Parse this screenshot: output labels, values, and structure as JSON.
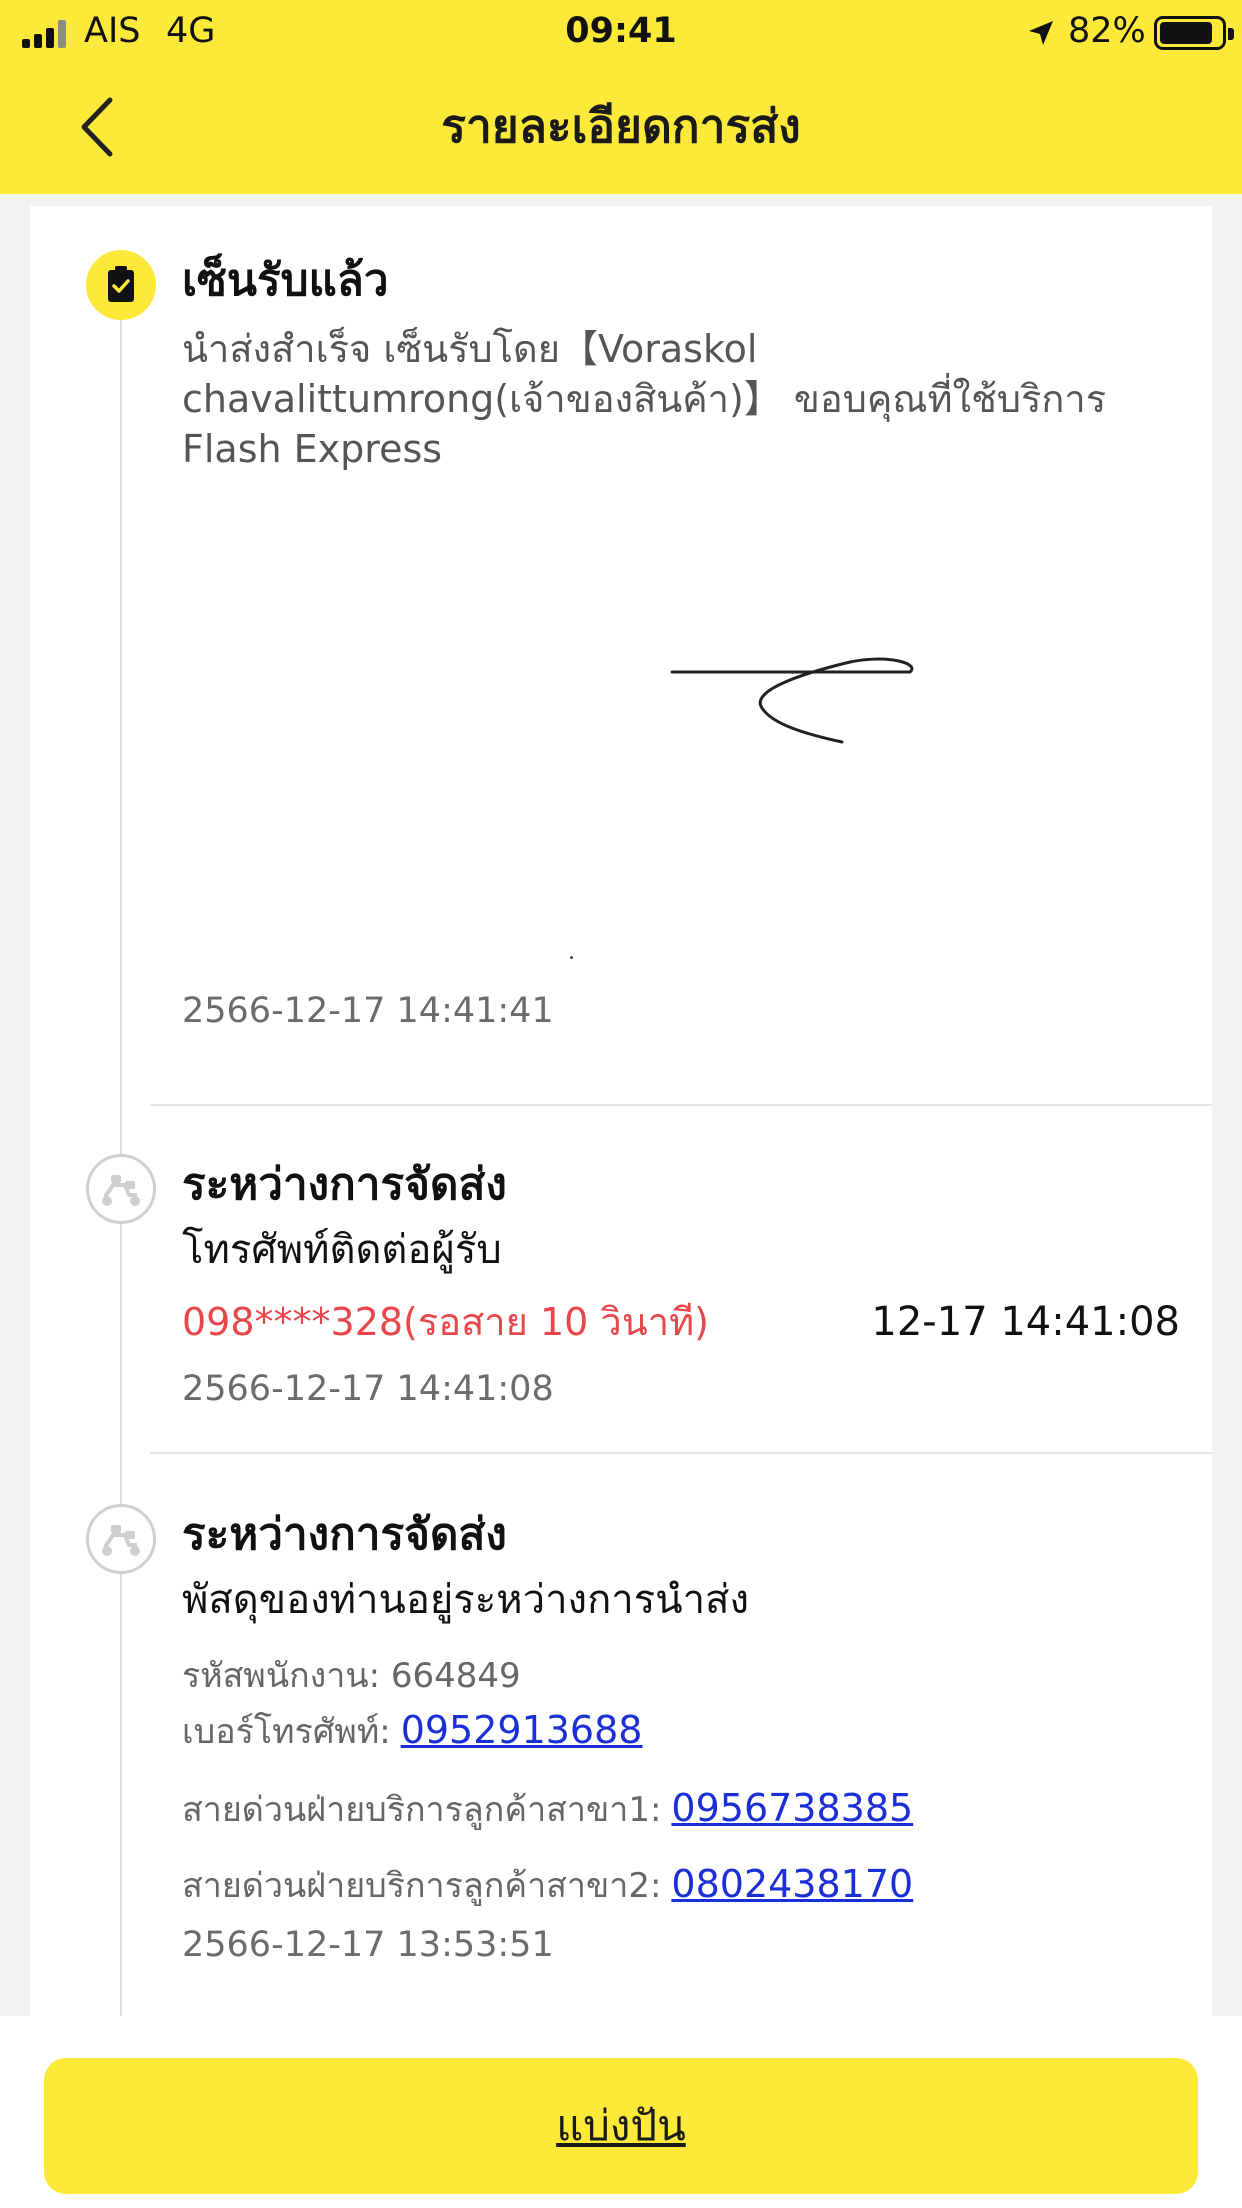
{
  "status_bar": {
    "carrier": "AIS",
    "network": "4G",
    "time": "09:41",
    "battery": "82%",
    "battery_level": 0.82
  },
  "header": {
    "title": "รายละเอียดการส่ง",
    "back_icon": "chevron-left-icon",
    "background": "#fde93a"
  },
  "events": [
    {
      "status": "เซ็นรับแล้ว",
      "icon": "clipboard-check-icon",
      "description": "นำส่งสำเร็จ เซ็นรับโดย【Voraskol chavalittumrong(เจ้าของสินค้า)】 ขอบคุณที่ใช้บริการ Flash Express",
      "timestamp": "2566-12-17 14:41:41"
    },
    {
      "status": "ระหว่างการจัดส่ง",
      "icon": "scooter-icon",
      "subtitle": "โทรศัพท์ติดต่อผู้รับ",
      "call_info": "098****328(รอสาย 10 วินาที)",
      "call_time": "12-17 14:41:08",
      "timestamp": "2566-12-17 14:41:08"
    },
    {
      "status": "ระหว่างการจัดส่ง",
      "icon": "scooter-icon",
      "subtitle": "พัสดุของท่านอยู่ระหว่างการนำส่ง",
      "staff_id": "รหัสพนักงาน: 664849",
      "phone_label": "เบอร์โทรศัพท์:",
      "phone": "0952913688",
      "hotline1_label": "สายด่วนฝ่ายบริการลูกค้าสาขา1:",
      "hotline1": "0956738385",
      "hotline2_label": "สายด่วนฝ่ายบริการลูกค้าสาขา2:",
      "hotline2": "0802438170",
      "timestamp": "2566-12-17 13:53:51"
    }
  ],
  "footer": {
    "share_label": "แบ่งปัน"
  },
  "colors": {
    "accent": "#fde93a",
    "alert": "#e8464a",
    "link": "#1b2fd6"
  }
}
